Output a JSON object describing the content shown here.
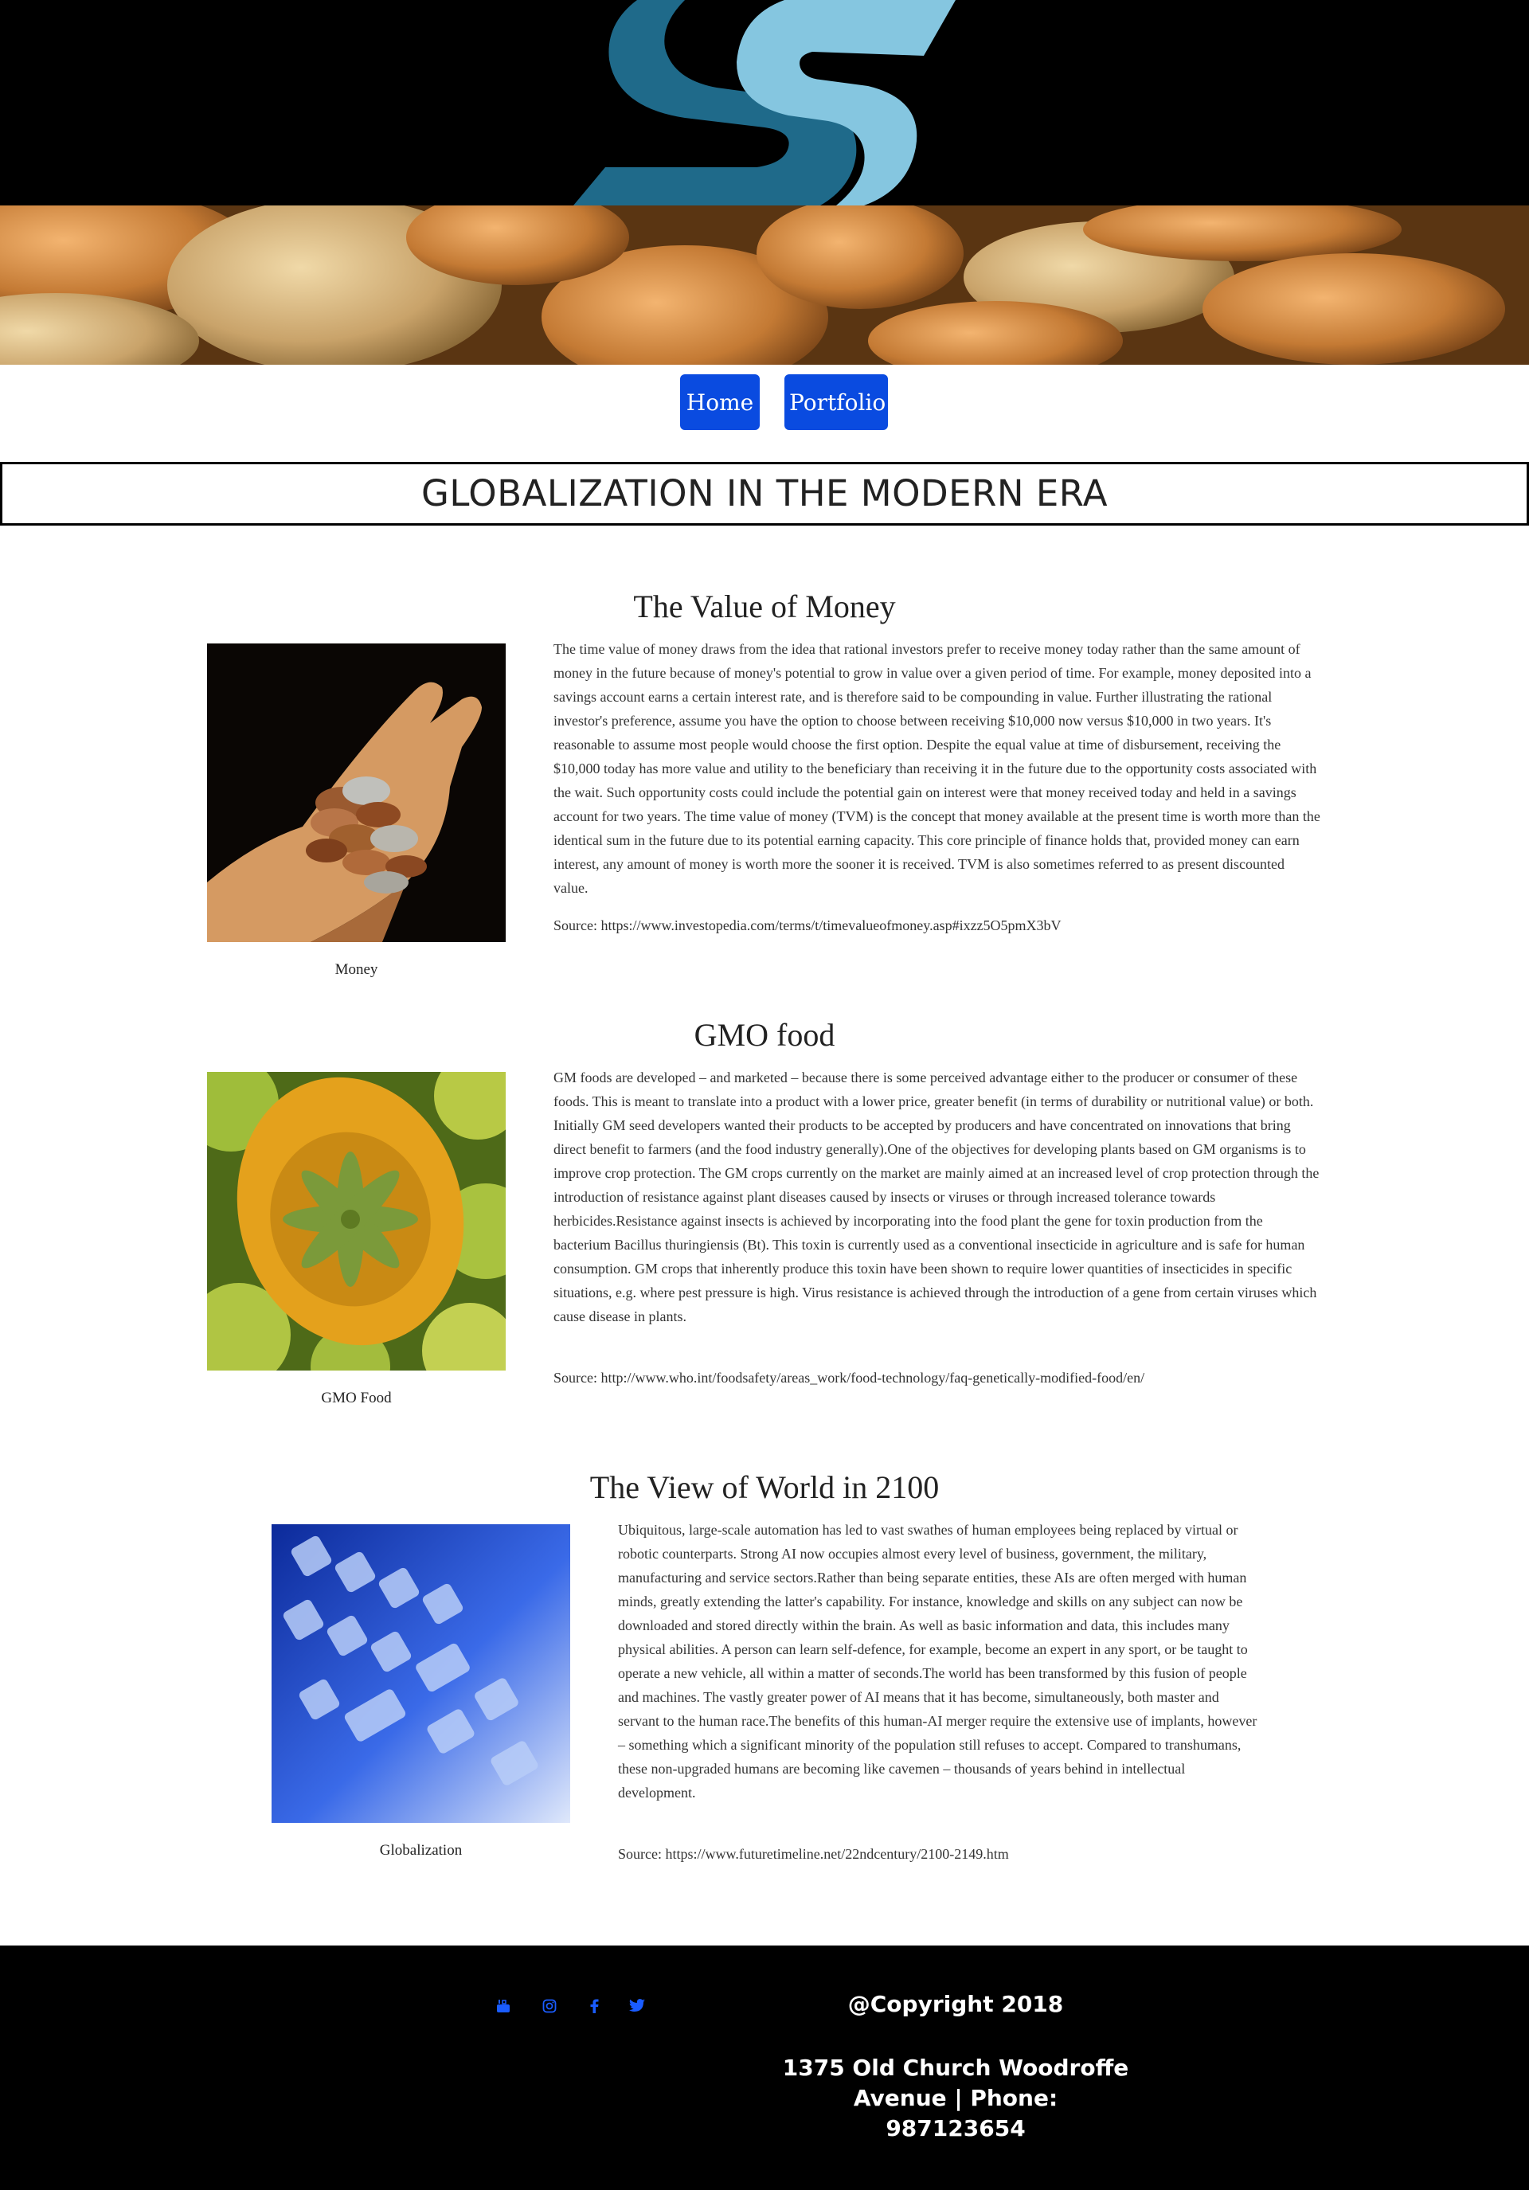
{
  "header": {
    "logo_alt": "SS logo",
    "banner_alt": "coins banner"
  },
  "nav": {
    "home_label": "Home",
    "portfolio_label": "Portfolio"
  },
  "page_title": "GLOBALIZATION IN THE MODERN ERA",
  "sections": [
    {
      "title": "The Value of Money",
      "caption": "Money",
      "body": "The time value of money draws from the idea that rational investors prefer to receive money today rather than the same amount of money in the future because of money's potential to grow in value over a given period of time. For example, money deposited into a savings account earns a certain interest rate, and is therefore said to be compounding in value. Further illustrating the rational investor's preference, assume you have the option to choose between receiving $10,000 now versus $10,000 in two years. It's reasonable to assume most people would choose the first option. Despite the equal value at time of disbursement, receiving the $10,000 today has more value and utility to the beneficiary than receiving it in the future due to the opportunity costs associated with the wait. Such opportunity costs could include the potential gain on interest were that money received today and held in a savings account for two years. The time value of money (TVM) is the concept that money available at the present time is worth more than the identical sum in the future due to its potential earning capacity. This core principle of finance holds that, provided money can earn interest, any amount of money is worth more the sooner it is received. TVM is also sometimes referred to as present discounted value.",
      "source": "Source: https://www.investopedia.com/terms/t/timevalueofmoney.asp#ixzz5O5pmX3bV"
    },
    {
      "title": "GMO food",
      "caption": "GMO Food",
      "body": "GM foods are developed – and marketed – because there is some perceived advantage either to the producer or consumer of these foods. This is meant to translate into a product with a lower price, greater benefit (in terms of durability or nutritional value) or both. Initially GM seed developers wanted their products to be accepted by producers and have concentrated on innovations that bring direct benefit to farmers (and the food industry generally).One of the objectives for developing plants based on GM organisms is to improve crop protection. The GM crops currently on the market are mainly aimed at an increased level of crop protection through the introduction of resistance against plant diseases caused by insects or viruses or through increased tolerance towards herbicides.Resistance against insects is achieved by incorporating into the food plant the gene for toxin production from the bacterium Bacillus thuringiensis (Bt). This toxin is currently used as a conventional insecticide in agriculture and is safe for human consumption. GM crops that inherently produce this toxin have been shown to require lower quantities of insecticides in specific situations, e.g. where pest pressure is high. Virus resistance is achieved through the introduction of a gene from certain viruses which cause disease in plants.",
      "source": "Source: http://www.who.int/foodsafety/areas_work/food-technology/faq-genetically-modified-food/en/"
    },
    {
      "title": "The View of World in 2100",
      "caption": "Globalization",
      "body": "Ubiquitous, large-scale automation has led to vast swathes of human employees being replaced by virtual or robotic counterparts. Strong AI now occupies almost every level of business, government, the military, manufacturing and service sectors.Rather than being separate entities, these AIs are often merged with human minds, greatly extending the latter's capability. For instance, knowledge and skills on any subject can now be downloaded and stored directly within the brain. As well as basic information and data, this includes many physical abilities. A person can learn self-defence, for example, become an expert in any sport, or be taught to operate a new vehicle, all within a matter of seconds.The world has been transformed by this fusion of people and machines. The vastly greater power of AI means that it has become, simultaneously, both master and servant to the human race.The benefits of this human-AI merger require the extensive use of implants, however – something which a significant minority of the population still refuses to accept. Compared to transhumans, these non-upgraded humans are becoming like cavemen – thousands of years behind in intellectual development.",
      "source": "Source: https://www.futuretimeline.net/22ndcentury/2100-2149.htm"
    }
  ],
  "footer": {
    "social_icons": [
      "youtube-icon",
      "instagram-icon",
      "facebook-icon",
      "twitter-icon"
    ],
    "copyright": "@Copyright 2018",
    "address": "1375 Old Church Woodroffe Avenue | Phone: 987123654"
  },
  "colors": {
    "nav_button": "#0a4be0",
    "social_icon": "#1a5cff",
    "logo_dark": "#1f6a8a",
    "logo_light": "#85c6e0"
  }
}
